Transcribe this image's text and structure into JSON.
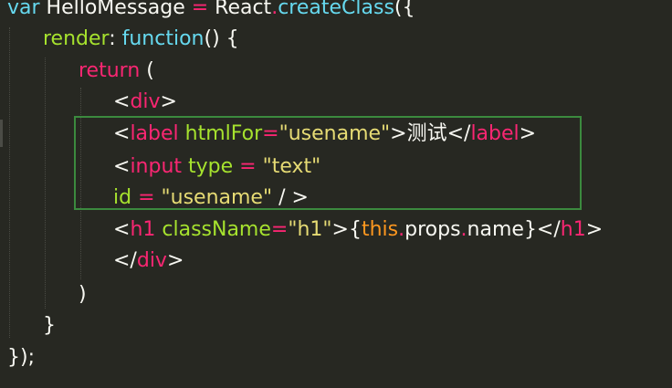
{
  "editor": {
    "colors": {
      "background": "#272822",
      "keyword": "#66d9ef",
      "function_name": "#a6e22e",
      "tag": "#f92672",
      "string": "#e6db74",
      "this": "#fd971f",
      "highlight_box": "#3b8a3e"
    },
    "lines": [
      {
        "tokens": [
          {
            "text": "var",
            "cls": "kw"
          },
          {
            "text": " HelloMessage ",
            "cls": "wht"
          },
          {
            "text": "=",
            "cls": "pink"
          },
          {
            "text": " React",
            "cls": "wht"
          },
          {
            "text": ".",
            "cls": "pink"
          },
          {
            "text": "createClass",
            "cls": "kw"
          },
          {
            "text": "({",
            "cls": "wht"
          }
        ]
      },
      {
        "tokens": [
          {
            "text": "render",
            "cls": "grn"
          },
          {
            "text": ": ",
            "cls": "wht"
          },
          {
            "text": "function",
            "cls": "kw"
          },
          {
            "text": "() {",
            "cls": "wht"
          }
        ]
      },
      {
        "tokens": [
          {
            "text": "return",
            "cls": "pink"
          },
          {
            "text": " (",
            "cls": "wht"
          }
        ]
      },
      {
        "tokens": [
          {
            "text": "<",
            "cls": "wht"
          },
          {
            "text": "div",
            "cls": "pink"
          },
          {
            "text": ">",
            "cls": "wht"
          }
        ]
      },
      {
        "tokens": [
          {
            "text": "<",
            "cls": "wht"
          },
          {
            "text": "label",
            "cls": "pink"
          },
          {
            "text": " htmlFor",
            "cls": "grn"
          },
          {
            "text": "=",
            "cls": "pink"
          },
          {
            "text": "\"usename\"",
            "cls": "str"
          },
          {
            "text": ">测试</",
            "cls": "wht"
          },
          {
            "text": "label",
            "cls": "pink"
          },
          {
            "text": ">",
            "cls": "wht"
          }
        ]
      },
      {
        "tokens": [
          {
            "text": "<",
            "cls": "wht"
          },
          {
            "text": "input",
            "cls": "pink"
          },
          {
            "text": " type ",
            "cls": "grn"
          },
          {
            "text": "=",
            "cls": "pink"
          },
          {
            "text": " \"text\"",
            "cls": "str"
          }
        ]
      },
      {
        "tokens": [
          {
            "text": "id ",
            "cls": "grn"
          },
          {
            "text": "=",
            "cls": "pink"
          },
          {
            "text": " \"usename\"",
            "cls": "str"
          },
          {
            "text": " / >",
            "cls": "wht"
          }
        ]
      },
      {
        "tokens": [
          {
            "text": "<",
            "cls": "wht"
          },
          {
            "text": "h1",
            "cls": "pink"
          },
          {
            "text": " className",
            "cls": "grn"
          },
          {
            "text": "=",
            "cls": "pink"
          },
          {
            "text": "\"h1\"",
            "cls": "str"
          },
          {
            "text": ">{",
            "cls": "wht"
          },
          {
            "text": "this",
            "cls": "org"
          },
          {
            "text": ".",
            "cls": "pink"
          },
          {
            "text": "props",
            "cls": "wht"
          },
          {
            "text": ".",
            "cls": "pink"
          },
          {
            "text": "name",
            "cls": "wht"
          },
          {
            "text": "}</",
            "cls": "wht"
          },
          {
            "text": "h1",
            "cls": "pink"
          },
          {
            "text": ">",
            "cls": "wht"
          }
        ]
      },
      {
        "tokens": [
          {
            "text": "</",
            "cls": "wht"
          },
          {
            "text": "div",
            "cls": "pink"
          },
          {
            "text": ">",
            "cls": "wht"
          }
        ]
      },
      {
        "tokens": [
          {
            "text": ")",
            "cls": "wht"
          }
        ]
      },
      {
        "tokens": [
          {
            "text": "}",
            "cls": "wht"
          }
        ]
      },
      {
        "tokens": [
          {
            "text": "});",
            "cls": "wht"
          }
        ]
      }
    ]
  }
}
